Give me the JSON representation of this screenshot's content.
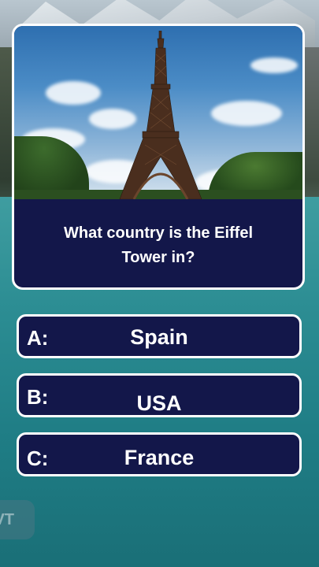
{
  "quiz": {
    "question": "What country is the Eiffel Tower in?",
    "image_subject": "eiffel-tower-photo",
    "answers": [
      {
        "letter": "A:",
        "text": "Spain"
      },
      {
        "letter": "B:",
        "text": "USA"
      },
      {
        "letter": "C:",
        "text": "France"
      }
    ]
  },
  "controls": {
    "next_label": "VT"
  },
  "colors": {
    "card_bg": "#13174a",
    "border": "#ffffff",
    "text": "#ffffff"
  }
}
